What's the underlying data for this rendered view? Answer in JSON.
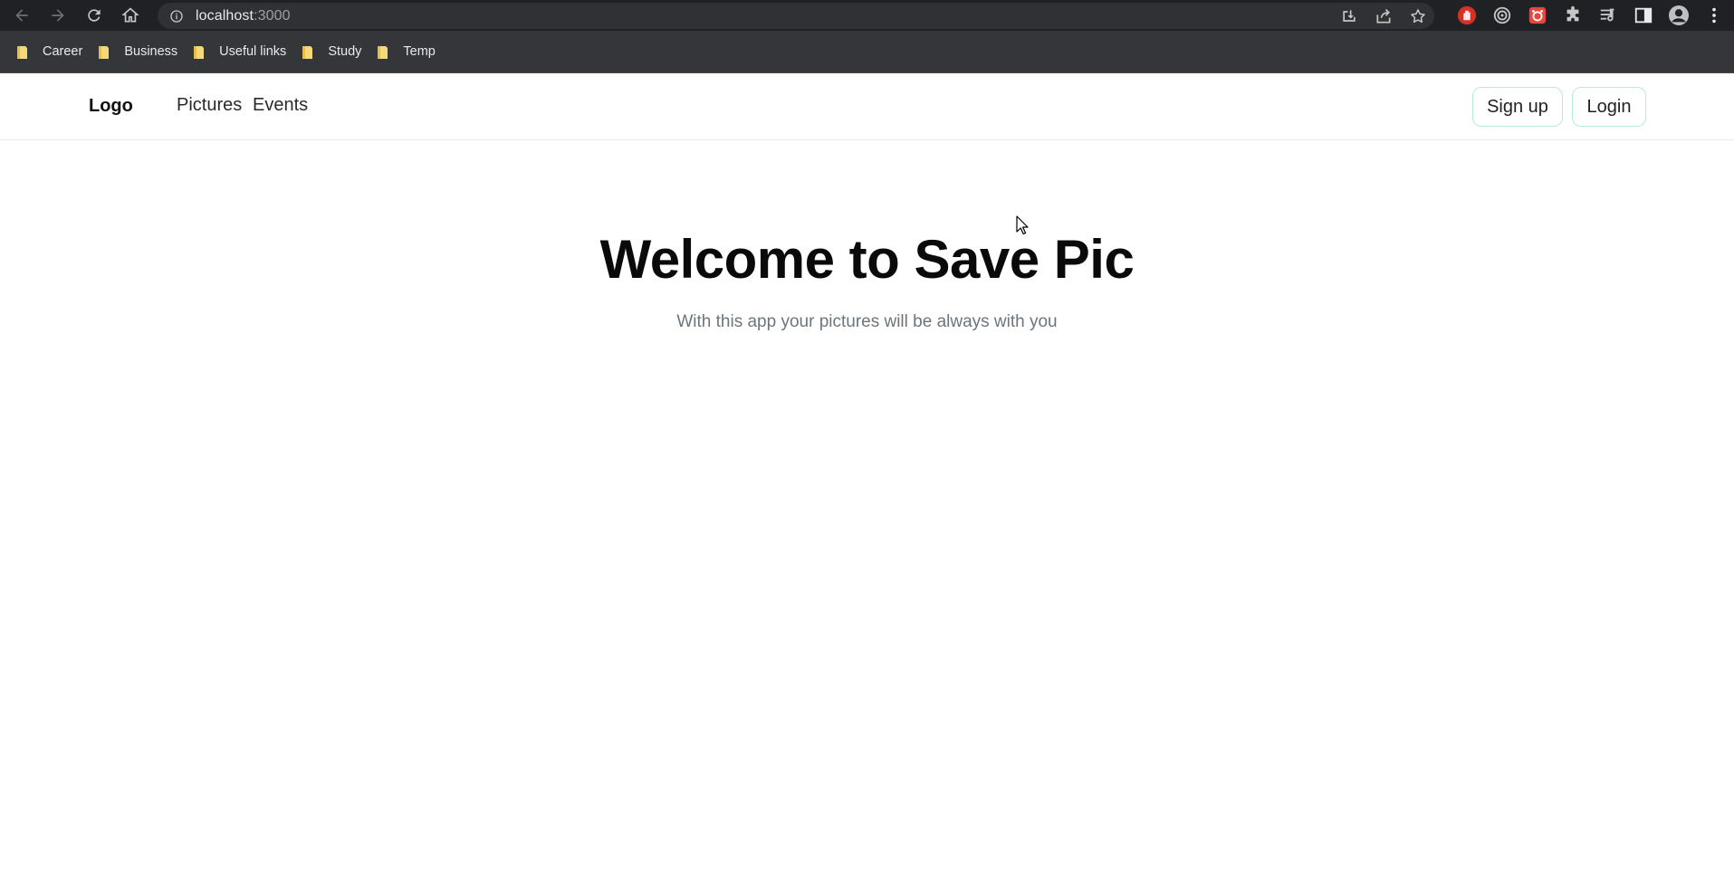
{
  "browser": {
    "url_host": "localhost",
    "url_port": ":3000",
    "bookmarks": [
      {
        "label": "Career"
      },
      {
        "label": "Business"
      },
      {
        "label": "Useful links"
      },
      {
        "label": "Study"
      },
      {
        "label": "Temp"
      }
    ],
    "extension_icons": [
      "hand-stop-icon",
      "target-icon",
      "red-extension-icon",
      "puzzle-extensions-icon",
      "reading-list-icon",
      "side-panel-icon",
      "profile-avatar-icon",
      "kebab-menu-icon"
    ]
  },
  "app": {
    "logo": "Logo",
    "nav": {
      "pictures": "Pictures",
      "events": "Events"
    },
    "buttons": {
      "signup": "Sign up",
      "login": "Login"
    },
    "hero": {
      "title": "Welcome to Save Pic",
      "subtitle": "With this app your pictures will be always with you"
    },
    "colors": {
      "button_border": "#b6ecd3",
      "subtitle": "#6c757d",
      "chrome_dark": "#202124"
    }
  }
}
